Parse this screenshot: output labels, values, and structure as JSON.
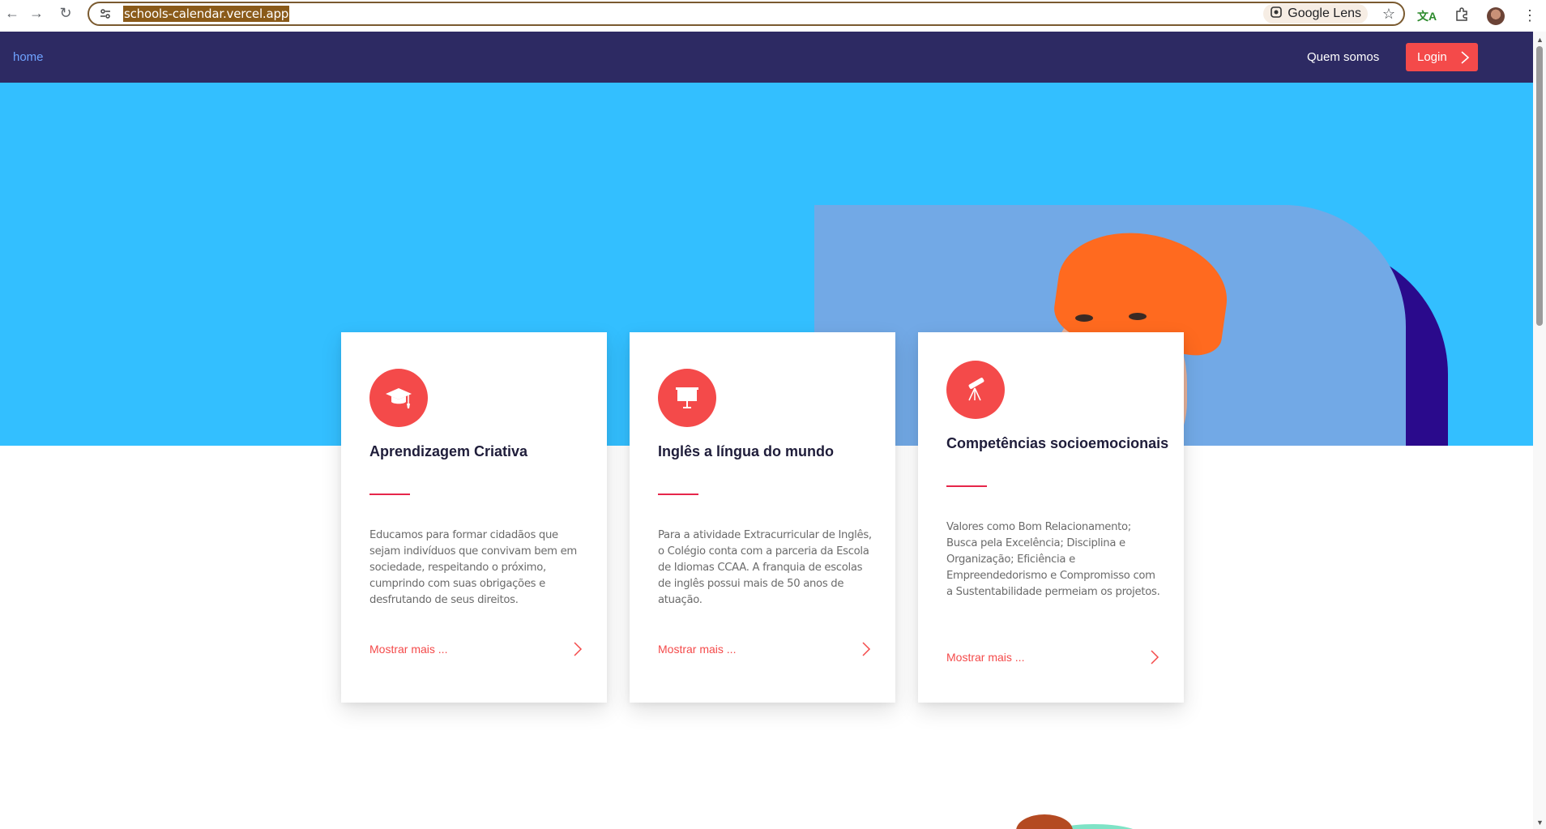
{
  "browser": {
    "url": "schools-calendar.vercel.app",
    "lens_label": "Google Lens"
  },
  "site_nav": {
    "home": "home",
    "quem_somos": "Quem somos",
    "login": "Login"
  },
  "cards": [
    {
      "title": "Aprendizagem Criativa",
      "icon": "graduation-cap-icon",
      "text": "Educamos para formar cidadãos que sejam indivíduos que convivam bem em sociedade, respeitando o próximo, cumprindo com suas obrigações e desfrutando de seus direitos.",
      "more": "Mostrar mais ..."
    },
    {
      "title": "Inglês a língua do mundo",
      "icon": "presentation-board-icon",
      "text": "Para a atividade Extracurricular de Inglês, o Colégio conta com a parceria da Escola de Idiomas CCAA. A franquia de escolas de inglês possui mais de 50 anos de atuação.",
      "more": "Mostrar mais ..."
    },
    {
      "title": "Competências socioemocionais",
      "icon": "telescope-icon",
      "text": "Valores como Bom Relacionamento; Busca pela Excelência; Disciplina e Organização; Eficiência e Empreendedorismo e Compromisso com a Sustentabilidade permeiam os projetos.",
      "more": "Mostrar mais ..."
    }
  ],
  "colors": {
    "nav_bg": "#2d2a63",
    "hero_bg": "#33bfff",
    "accent": "#f44a4a"
  }
}
